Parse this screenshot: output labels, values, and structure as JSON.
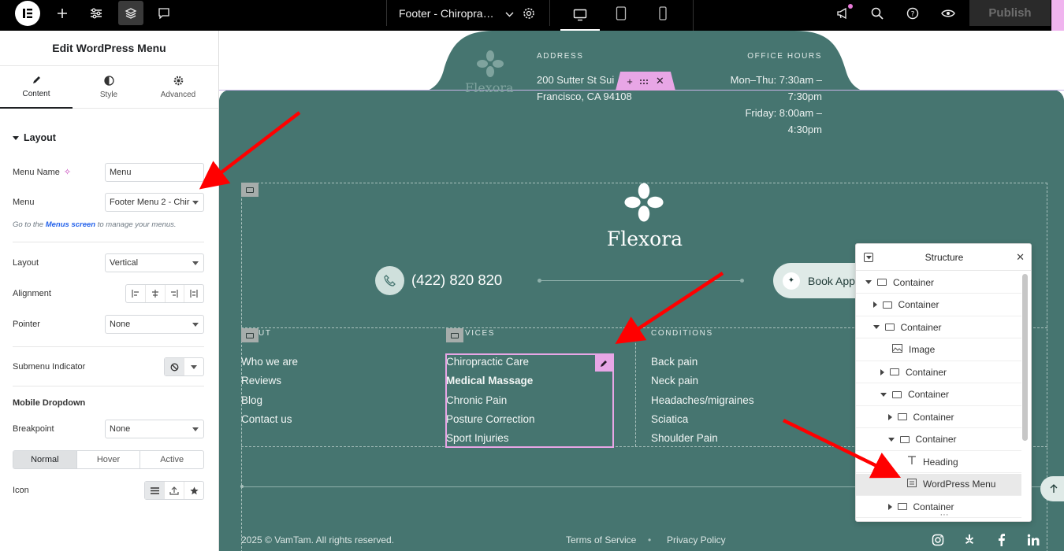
{
  "topbar": {
    "doc_title": "Footer - Chiropra…",
    "publish_label": "Publish"
  },
  "panel": {
    "title": "Edit WordPress Menu",
    "tabs": [
      {
        "label": "Content",
        "icon": "pencil-icon"
      },
      {
        "label": "Style",
        "icon": "contrast-icon"
      },
      {
        "label": "Advanced",
        "icon": "gear-icon"
      }
    ],
    "section_layout": "Layout",
    "menu_name_label": "Menu Name",
    "menu_name_value": "Menu",
    "menu_label": "Menu",
    "menu_value": "Footer Menu 2 - Chir",
    "help_prefix": "Go to the",
    "help_link": "Menus screen",
    "help_suffix": "to manage your menus.",
    "layout_label": "Layout",
    "layout_value": "Vertical",
    "alignment_label": "Alignment",
    "pointer_label": "Pointer",
    "pointer_value": "None",
    "submenu_label": "Submenu Indicator",
    "mobile_heading": "Mobile Dropdown",
    "breakpoint_label": "Breakpoint",
    "breakpoint_value": "None",
    "state_tabs": [
      "Normal",
      "Hover",
      "Active"
    ],
    "icon_label": "Icon"
  },
  "canvas": {
    "top_logo_text": "Flexora",
    "address_heading": "ADDRESS",
    "address_line1": "200 Sutter St Sui",
    "address_line2": "Francisco, CA 94108",
    "hours_heading": "OFFICE HOURS",
    "hours_line1": "Mon–Thu: 7:30am –",
    "hours_line2": "7:30pm",
    "hours_line3": "Friday: 8:00am –",
    "hours_line4": "4:30pm",
    "brand": "Flexora",
    "phone": "(422) 820 820",
    "book_button": "Book App",
    "about_heading": "UT",
    "services_heading": "VICES",
    "conditions_heading": "CONDITIONS",
    "about_items": [
      "Who we are",
      "Reviews",
      "Blog",
      "Contact us"
    ],
    "services_items": [
      "Chiropractic Care",
      "Medical Massage",
      "Chronic Pain",
      "Posture Correction",
      "Sport Injuries"
    ],
    "conditions_items": [
      "Back pain",
      "Neck pain",
      "Headaches/migraines",
      "Sciatica",
      "Shoulder Pain"
    ],
    "copyright": "2025 © VamTam. All rights reserved.",
    "terms": "Terms of Service",
    "privacy": "Privacy Policy",
    "dot": "•"
  },
  "structure": {
    "title": "Structure",
    "more": "···",
    "rows": [
      {
        "label": "Container",
        "toggle": "down",
        "icon": "container-icon"
      },
      {
        "label": "Container",
        "toggle": "right",
        "icon": "container-icon"
      },
      {
        "label": "Container",
        "toggle": "down",
        "icon": "container-icon"
      },
      {
        "label": "Image",
        "toggle": "none",
        "icon": "image-icon"
      },
      {
        "label": "Container",
        "toggle": "right",
        "icon": "container-icon"
      },
      {
        "label": "Container",
        "toggle": "down",
        "icon": "container-icon"
      },
      {
        "label": "Container",
        "toggle": "right",
        "icon": "container-icon"
      },
      {
        "label": "Container",
        "toggle": "down",
        "icon": "container-icon"
      },
      {
        "label": "Heading",
        "toggle": "none",
        "icon": "heading-icon"
      },
      {
        "label": "WordPress Menu",
        "toggle": "none",
        "icon": "menu-icon"
      },
      {
        "label": "Container",
        "toggle": "right",
        "icon": "container-icon"
      }
    ]
  },
  "colors": {
    "teal": "#467570",
    "selection": "#e8a6e6",
    "annotation_arrow": "#ff0000",
    "link_blue": "#2563eb"
  }
}
